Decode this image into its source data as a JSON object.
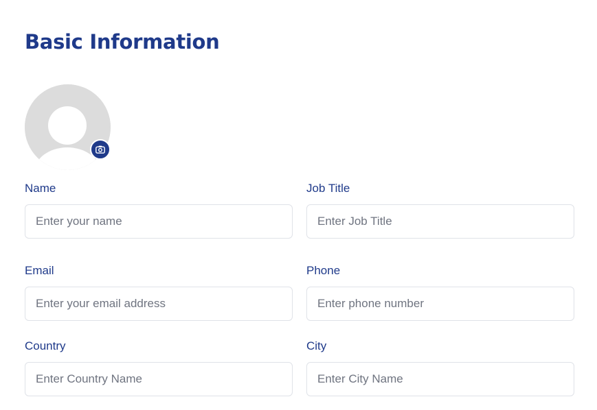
{
  "section": {
    "title": "Basic Information"
  },
  "avatar": {
    "icon": "user-placeholder-icon",
    "upload_icon": "camera-icon",
    "accent_color": "#1f3a8a"
  },
  "fields": {
    "name": {
      "label": "Name",
      "placeholder": "Enter your name"
    },
    "job_title": {
      "label": "Job Title",
      "placeholder": "Enter Job Title"
    },
    "email": {
      "label": "Email",
      "placeholder": "Enter your email address"
    },
    "phone": {
      "label": "Phone",
      "placeholder": "Enter phone number"
    },
    "country": {
      "label": "Country",
      "placeholder": "Enter Country Name"
    },
    "city": {
      "label": "City",
      "placeholder": "Enter City Name"
    }
  }
}
